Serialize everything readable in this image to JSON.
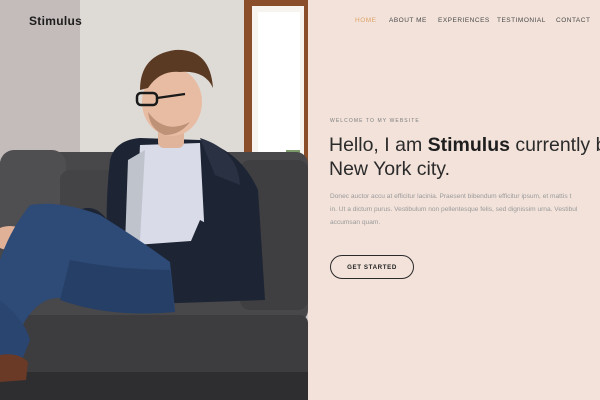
{
  "brand": {
    "name": "Stimulus"
  },
  "nav": {
    "items": [
      {
        "label": "HOME",
        "active": true
      },
      {
        "label": "ABOUT ME",
        "active": false
      },
      {
        "label": "EXPERIENCES",
        "active": false
      },
      {
        "label": "TESTIMONIAL",
        "active": false
      },
      {
        "label": "CONTACT",
        "active": false
      }
    ]
  },
  "hero": {
    "eyebrow": "WELCOME TO MY WEBSITE",
    "headline": {
      "prefix": "Hello, I am ",
      "name": "Stimulus",
      "suffix": " currently ba",
      "line2": "New York city."
    },
    "intro_lines": [
      "Donec auctor accu at efficitur lacinia. Praesent bibendum efficitur ipsum, et mattis t",
      "in. Ut a dictum purus. Vestibulum non pellentesque felis, sed dignissim urna. Vestibul",
      "accumsan quam."
    ],
    "cta_label": "GET STARTED"
  },
  "colors": {
    "background": "#f2e2da",
    "accent": "#e0a56a",
    "text_dark": "#2b2b2b"
  }
}
